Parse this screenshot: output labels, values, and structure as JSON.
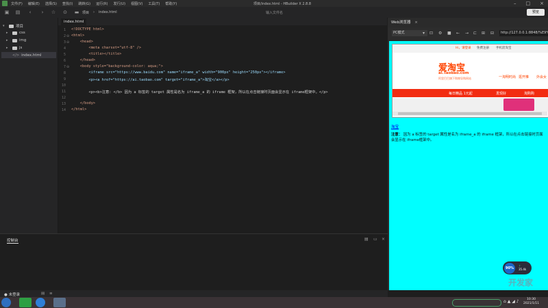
{
  "menu": [
    "文件(F)",
    "编辑(E)",
    "选择(S)",
    "查找(I)",
    "跳转(G)",
    "运行(R)",
    "发行(U)",
    "视图(V)",
    "工具(T)",
    "帮助(Y)"
  ],
  "window_title": "项目/index.html - HBuilder X 2.8.8",
  "toolbar": {
    "breadcrumb_project": "项目",
    "breadcrumb_file": "index.html",
    "file_search_placeholder": "输入文件名",
    "preview_label": "预览"
  },
  "sidebar": {
    "items": [
      {
        "label": "项目",
        "level": 0,
        "expanded": true
      },
      {
        "label": "css",
        "level": 1,
        "expanded": false
      },
      {
        "label": "img",
        "level": 1,
        "expanded": false
      },
      {
        "label": "js",
        "level": 1,
        "expanded": false
      },
      {
        "label": "index.html",
        "level": 1,
        "file": true
      }
    ]
  },
  "editor": {
    "tab_label": "index.html",
    "line_numbers": [
      "1",
      "2",
      "3",
      "4",
      "5",
      "6",
      "7",
      "8",
      "9",
      "10",
      "11",
      "12",
      "13",
      "14"
    ],
    "lines": [
      "<!DOCTYPE html>",
      "<html>",
      "    <head>",
      "        <meta charset=\"utf-8\" />",
      "        <title></title>",
      "    </head>",
      "    <body style=\"background-color: aqua;\">",
      "        <iframe src=\"https://www.baidu.com\" name=\"iframe_a\" width=\"900px\" height=\"250px\"></iframe>",
      "        <p><a href=\"https://ai.taobao.com\" target=\"iframe_a\">淘宝</a></p>",
      "",
      "        <p><b>注意: </b> 因为 a 标签的 target 属性是名为 iframe_a 的 iframe 框架，所以在点击链接时页面会显示在 iframe框架中。</p>",
      "",
      "    </body>",
      "</html>"
    ]
  },
  "console": {
    "tab_label": "控制台"
  },
  "status": {
    "user": "未登录"
  },
  "browser": {
    "tab_label": "Web浏览器",
    "mode": "PC模式",
    "url": "http://127.0.0.1:8848/%E9%",
    "link_text": "淘宝",
    "note_bold": "注意：",
    "note_text": "因为 a 标签的 target 属性是名为 iframe_a 的 iframe 框架，所以在点击链接时页面会显示在 iframe框架中。",
    "iframe": {
      "top_links": [
        "Hi，请登录",
        "免费注册",
        "手机逛淘宝"
      ],
      "logo": "爱淘宝",
      "domain": "ai.Taobao.com",
      "slogan": "阿里巴巴旗下购物导购网站",
      "links": [
        "一淘明时尚",
        "逛开推",
        "外会女"
      ],
      "nav": [
        "每日精品 1元起",
        "发现好",
        "淘购购"
      ]
    },
    "badge": {
      "percent": "90%",
      "kb": "35.4k"
    }
  },
  "taskbar": {
    "time": "10:30",
    "date": "2021/1/11",
    "watermark": "开发家"
  }
}
